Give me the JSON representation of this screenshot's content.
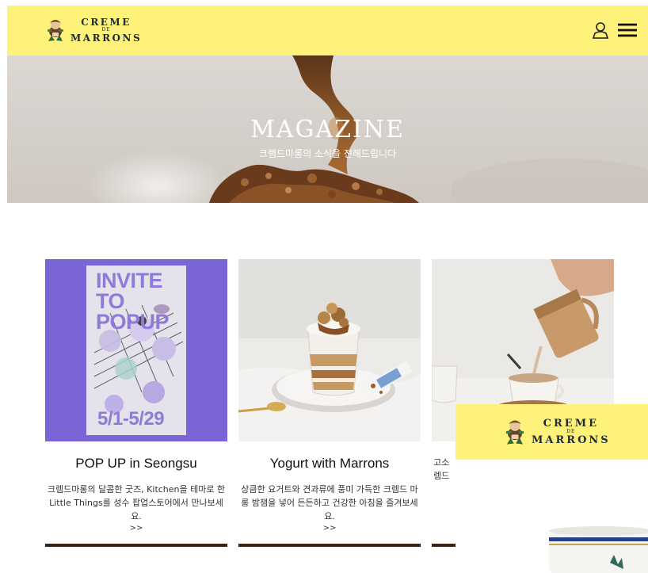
{
  "brand": {
    "line1": "CREME",
    "line2": "DE",
    "line3": "MARRONS"
  },
  "header": {
    "icons": [
      "user-icon",
      "menu-icon"
    ]
  },
  "hero": {
    "title": "MAGAZINE",
    "subtitle": "크렘드마롱의 소식을 전해드립니다"
  },
  "cards": [
    {
      "title": "POP UP in Seongsu",
      "description": "크렘드마롱의 달콤한 굿즈, Kitchen을 테마로 한 Little Things를 성수 팝업스토어에서 만나보세요.",
      "more": ">>",
      "poster": {
        "headline1": "INVITE",
        "headline2": "TO",
        "headline3": "POPUP",
        "dates": "5/1-5/29"
      }
    },
    {
      "title": "Yogurt with Marrons",
      "description": "상큼한 요거트와 견과류에 풍미 가득한 크렘드 마롱 밤잼을 넣어 든든하고 건강한 아침을 즐겨보세요.",
      "more": ">>"
    },
    {
      "title": "",
      "description_line1": "고소",
      "description_line2": "렘드",
      "more": ""
    }
  ],
  "colors": {
    "header_bg": "#fff27a",
    "card_bar": "#3a2418",
    "poster_bg": "#7b64d6"
  }
}
